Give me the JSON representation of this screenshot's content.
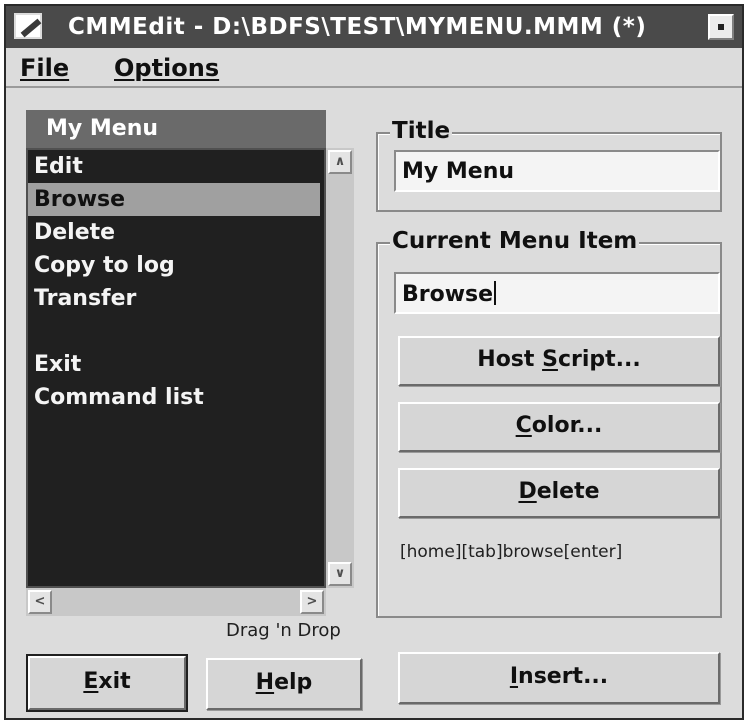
{
  "window": {
    "title": "CMMEdit - D:\\BDFS\\TEST\\MYMENU.MMM (*)"
  },
  "menubar": {
    "file": "File",
    "options": "Options"
  },
  "list": {
    "header": "My Menu",
    "items": [
      {
        "label": "Edit",
        "selected": false
      },
      {
        "label": "Browse",
        "selected": true
      },
      {
        "label": "Delete",
        "selected": false
      },
      {
        "label": "Copy to log",
        "selected": false
      },
      {
        "label": "Transfer",
        "selected": false
      },
      {
        "label": "",
        "selected": false
      },
      {
        "label": "Exit",
        "selected": false
      },
      {
        "label": "Command list",
        "selected": false
      }
    ],
    "drag_hint": "Drag 'n Drop"
  },
  "title_group": {
    "label": "Title",
    "value": "My Menu"
  },
  "item_group": {
    "label": "Current Menu Item",
    "value": "Browse",
    "host_script_label": {
      "pre": "Host ",
      "key": "S",
      "post": "cript..."
    },
    "color_label": {
      "pre": "",
      "key": "C",
      "post": "olor..."
    },
    "delete_label": {
      "pre": "",
      "key": "D",
      "post": "elete"
    },
    "command": "[home][tab]browse[enter]"
  },
  "bottom": {
    "exit_label": {
      "key": "E",
      "post": "xit"
    },
    "help_label": {
      "key": "H",
      "post": "elp"
    },
    "insert_label": {
      "key": "I",
      "post": "nsert..."
    }
  },
  "icons": {
    "app": "pen-app-icon",
    "minimize": "minimize-icon",
    "scroll_up": "arrow-up-icon",
    "scroll_down": "arrow-down-icon",
    "scroll_left": "arrow-left-icon",
    "scroll_right": "arrow-right-icon"
  },
  "colors": {
    "titlebar": "#4a4a4a",
    "list_background": "#202020",
    "selection": "#a0a0a0",
    "dialog": "#dcdcdc"
  }
}
